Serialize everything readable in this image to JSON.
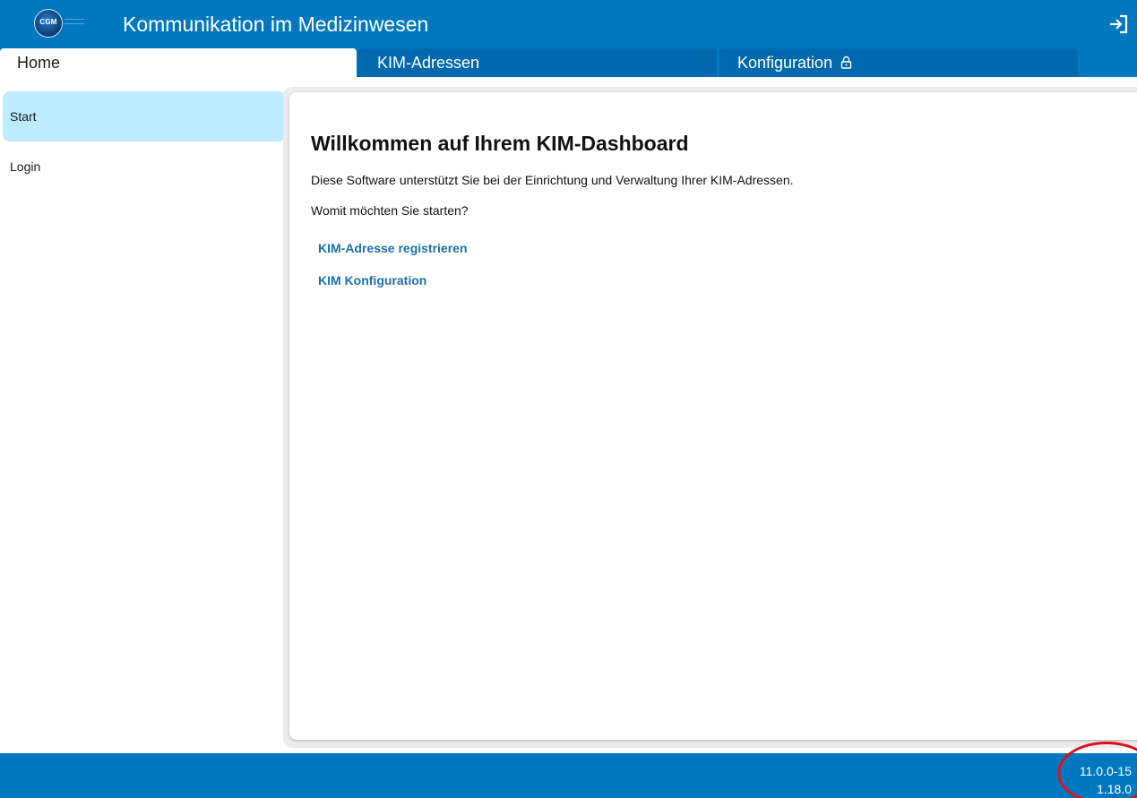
{
  "header": {
    "logo_text": "CGM",
    "title": "Kommunikation im Medizinwesen",
    "logout_icon": "logout-icon"
  },
  "tabs": [
    {
      "label": "Home",
      "active": true
    },
    {
      "label": "KIM-Adressen",
      "active": false
    },
    {
      "label": "Konfiguration",
      "active": false,
      "icon": "lock-icon"
    }
  ],
  "sidebar": {
    "items": [
      {
        "label": "Start",
        "active": true
      },
      {
        "label": "Login",
        "active": false
      }
    ]
  },
  "main": {
    "heading": "Willkommen auf Ihrem KIM-Dashboard",
    "intro": "Diese Software unterstützt Sie bei der Einrichtung und Verwaltung Ihrer KIM-Adressen.",
    "question": "Womit möchten Sie starten?",
    "links": [
      {
        "label": "KIM-Adresse registrieren"
      },
      {
        "label": "KIM Konfiguration"
      }
    ]
  },
  "footer": {
    "version_primary": "11.0.0-15",
    "version_secondary": "1.18.0"
  },
  "colors": {
    "brand_blue": "#0078bf",
    "tab_inactive": "#0068ad",
    "sidebar_active": "#bcecfd",
    "link": "#1a6fad",
    "annotation": "#e0101a"
  }
}
